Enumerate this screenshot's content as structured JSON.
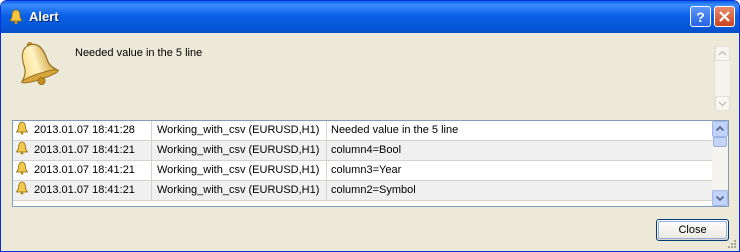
{
  "window": {
    "title": "Alert"
  },
  "icons": {
    "title_icon": "bell-icon",
    "main_icon": "bell-icon",
    "help": "help-icon",
    "close": "close-icon"
  },
  "message": "Needed value in the 5 line",
  "rows": [
    {
      "time": "2013.01.07 18:41:28",
      "source": "Working_with_csv (EURUSD,H1)",
      "text": "Needed value in the 5 line"
    },
    {
      "time": "2013.01.07 18:41:21",
      "source": "Working_with_csv (EURUSD,H1)",
      "text": "column4=Bool"
    },
    {
      "time": "2013.01.07 18:41:21",
      "source": "Working_with_csv (EURUSD,H1)",
      "text": "column3=Year"
    },
    {
      "time": "2013.01.07 18:41:21",
      "source": "Working_with_csv (EURUSD,H1)",
      "text": "column2=Symbol"
    }
  ],
  "buttons": {
    "close_label": "Close"
  },
  "colors": {
    "titlebar": "#0a5fe8",
    "window_bg": "#ece9d8",
    "close_red": "#c9431f"
  }
}
